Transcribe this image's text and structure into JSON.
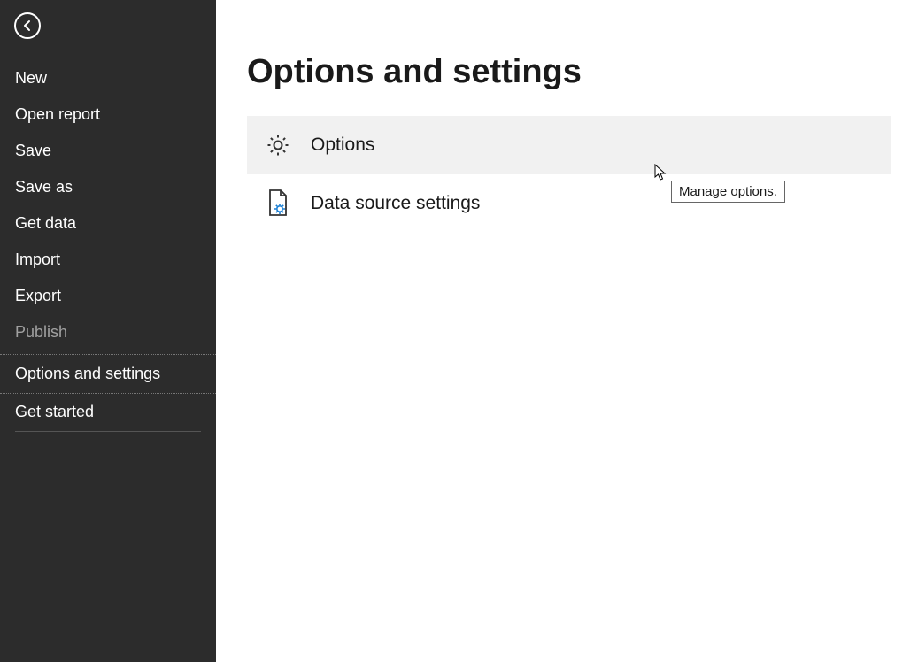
{
  "sidebar": {
    "items": [
      {
        "label": "New"
      },
      {
        "label": "Open report"
      },
      {
        "label": "Save"
      },
      {
        "label": "Save as"
      },
      {
        "label": "Get data"
      },
      {
        "label": "Import"
      },
      {
        "label": "Export"
      },
      {
        "label": "Publish"
      },
      {
        "label": "Options and settings"
      },
      {
        "label": "Get started"
      }
    ]
  },
  "main": {
    "title": "Options and settings",
    "rows": [
      {
        "label": "Options"
      },
      {
        "label": "Data source settings"
      }
    ]
  },
  "tooltip": {
    "text": "Manage options."
  }
}
